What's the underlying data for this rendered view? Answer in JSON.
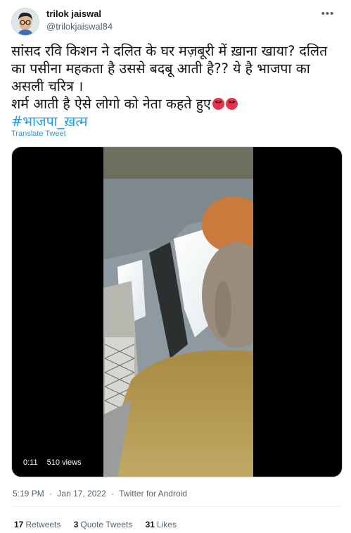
{
  "user": {
    "display_name": "trilok jaiswal",
    "handle": "@trilokjaiswal84"
  },
  "more_icon": "•••",
  "tweet": {
    "lines": [
      "सांसद रवि किशन ने दलित के घर मज़बूरी में ख़ाना खाया? दलित",
      "का पसीना महकता है उससे बदबू आती है?? ये है भाजपा का",
      "असली चरित्र ।",
      "शर्म आती है ऐसे लोगो को नेता कहते हुए"
    ],
    "emoji": [
      "angry-face",
      "angry-face"
    ],
    "hashtag": "#भाजपा_ख़त्म",
    "translate": "Translate Tweet"
  },
  "video": {
    "duration": "0:11",
    "views": "510 views"
  },
  "meta": {
    "time": "5:19 PM",
    "date": "Jan 17, 2022",
    "source": "Twitter for Android",
    "separator": "·"
  },
  "stats": {
    "retweets_count": "17",
    "retweets_label": "Retweets",
    "quotes_count": "3",
    "quotes_label": "Quote Tweets",
    "likes_count": "31",
    "likes_label": "Likes"
  }
}
